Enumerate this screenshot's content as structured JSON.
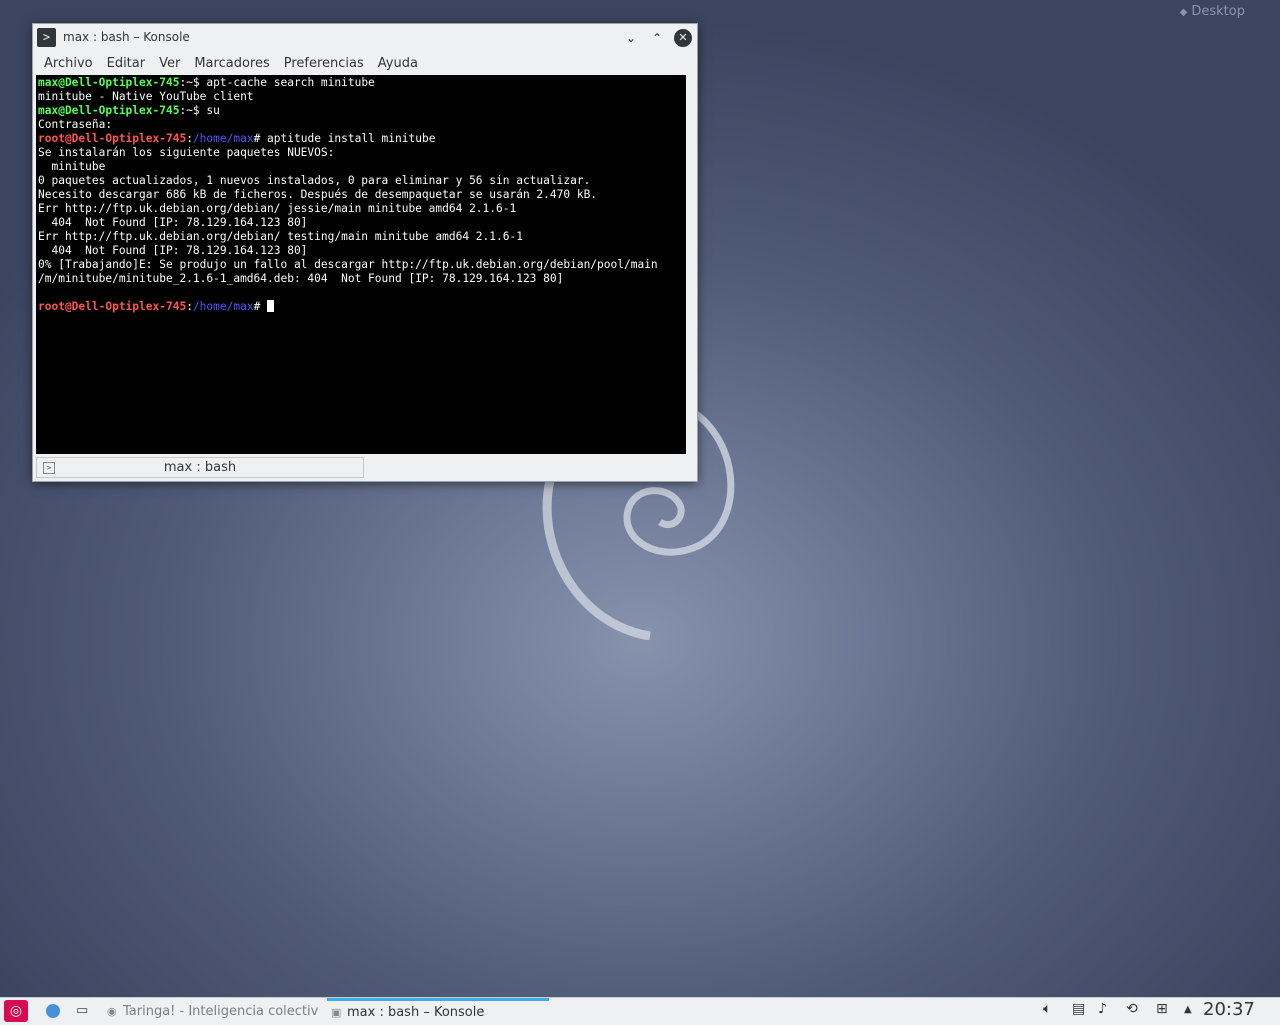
{
  "desktop": {
    "label": "Desktop"
  },
  "window": {
    "title": "max : bash – Konsole",
    "app_icon": "terminal-prompt-icon",
    "menu": [
      "Archivo",
      "Editar",
      "Ver",
      "Marcadores",
      "Preferencias",
      "Ayuda"
    ],
    "tab_label": "max : bash"
  },
  "terminal": {
    "lines": [
      {
        "prompt": "max@Dell-Optiplex-745",
        "sep": ":~$ ",
        "cmd": "apt-cache search minitube"
      },
      {
        "text": "minitube - Native YouTube client"
      },
      {
        "prompt": "max@Dell-Optiplex-745",
        "sep": ":~$ ",
        "cmd": "su"
      },
      {
        "text": "Contraseña:"
      },
      {
        "root": "root@Dell-Optiplex-745",
        "sep1": ":",
        "path": "/home/max",
        "sep2": "# ",
        "cmd": "aptitude install minitube"
      },
      {
        "text": "Se instalarán los siguiente paquetes NUEVOS:"
      },
      {
        "text": "  minitube"
      },
      {
        "text": "0 paquetes actualizados, 1 nuevos instalados, 0 para eliminar y 56 sin actualizar."
      },
      {
        "text": "Necesito descargar 686 kB de ficheros. Después de desempaquetar se usarán 2.470 kB."
      },
      {
        "text": "Err http://ftp.uk.debian.org/debian/ jessie/main minitube amd64 2.1.6-1"
      },
      {
        "text": "  404  Not Found [IP: 78.129.164.123 80]"
      },
      {
        "text": "Err http://ftp.uk.debian.org/debian/ testing/main minitube amd64 2.1.6-1"
      },
      {
        "text": "  404  Not Found [IP: 78.129.164.123 80]"
      },
      {
        "text": "0% [Trabajando]E: Se produjo un fallo al descargar http://ftp.uk.debian.org/debian/pool/main"
      },
      {
        "text": "/m/minitube/minitube_2.1.6-1_amd64.deb: 404  Not Found [IP: 78.129.164.123 80]"
      },
      {
        "text": ""
      },
      {
        "root": "root@Dell-Optiplex-745",
        "sep1": ":",
        "path": "/home/max",
        "sep2": "# ",
        "cmd": "",
        "cursor": true
      }
    ]
  },
  "taskbar": {
    "tasks": [
      {
        "label": "Taringa! - Inteligencia colectiva",
        "active": false
      },
      {
        "label": "max : bash – Konsole",
        "active": true
      }
    ],
    "tray_icons": [
      "volume-icon",
      "clipboard-icon",
      "speaker-icon",
      "updates-icon",
      "network-icon",
      "expand-tray-icon"
    ],
    "clock": "20:37"
  }
}
